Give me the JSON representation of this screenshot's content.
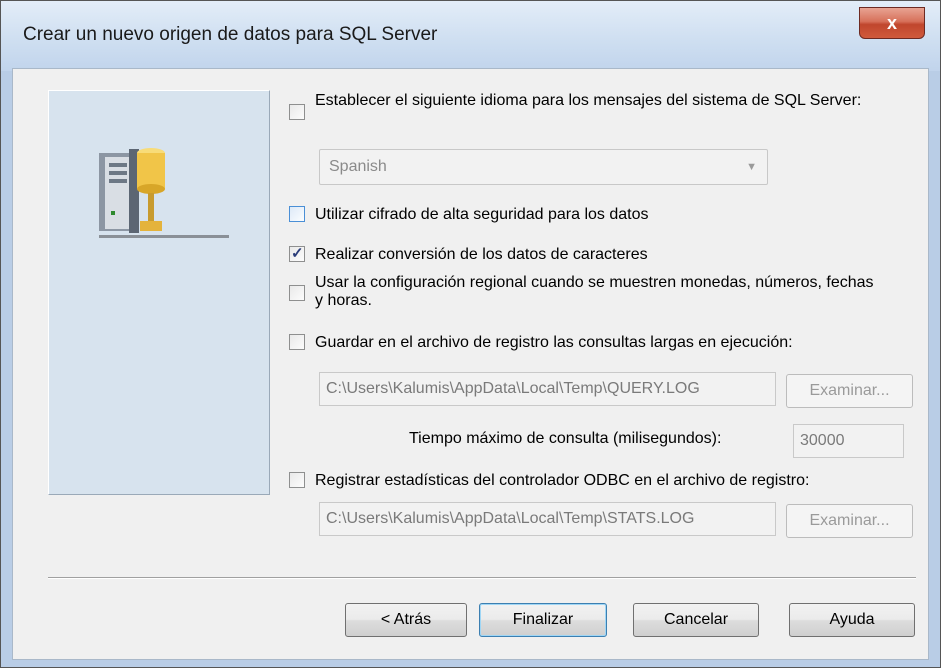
{
  "window": {
    "title": "Crear un nuevo origen de datos para SQL Server",
    "close_label": "x"
  },
  "options": {
    "language": {
      "label": "Establecer el siguiente idioma para los mensajes del sistema de SQL Server:",
      "checked": false,
      "selected": "Spanish"
    },
    "encryption": {
      "label": "Utilizar cifrado de alta seguridad para los datos",
      "checked": false
    },
    "char_conversion": {
      "label": "Realizar conversión de los datos de caracteres",
      "checked": true,
      "check_glyph": "✓"
    },
    "regional": {
      "label": "Usar la configuración regional cuando se muestren monedas, números, fechas y horas.",
      "checked": false
    },
    "long_queries": {
      "label": "Guardar en el archivo de registro las consultas largas en ejecución:",
      "checked": false,
      "path": "C:\\Users\\Kalumis\\AppData\\Local\\Temp\\QUERY.LOG",
      "browse": "Examinar...",
      "timeout_label": "Tiempo máximo de consulta (milisegundos):",
      "timeout_value": "30000"
    },
    "stats": {
      "label": "Registrar estadísticas del controlador ODBC en el archivo de registro:",
      "checked": false,
      "path": "C:\\Users\\Kalumis\\AppData\\Local\\Temp\\STATS.LOG",
      "browse": "Examinar..."
    }
  },
  "buttons": {
    "back": "< Atrás",
    "finish": "Finalizar",
    "cancel": "Cancelar",
    "help": "Ayuda"
  },
  "icons": {
    "server": "database-server-icon"
  }
}
